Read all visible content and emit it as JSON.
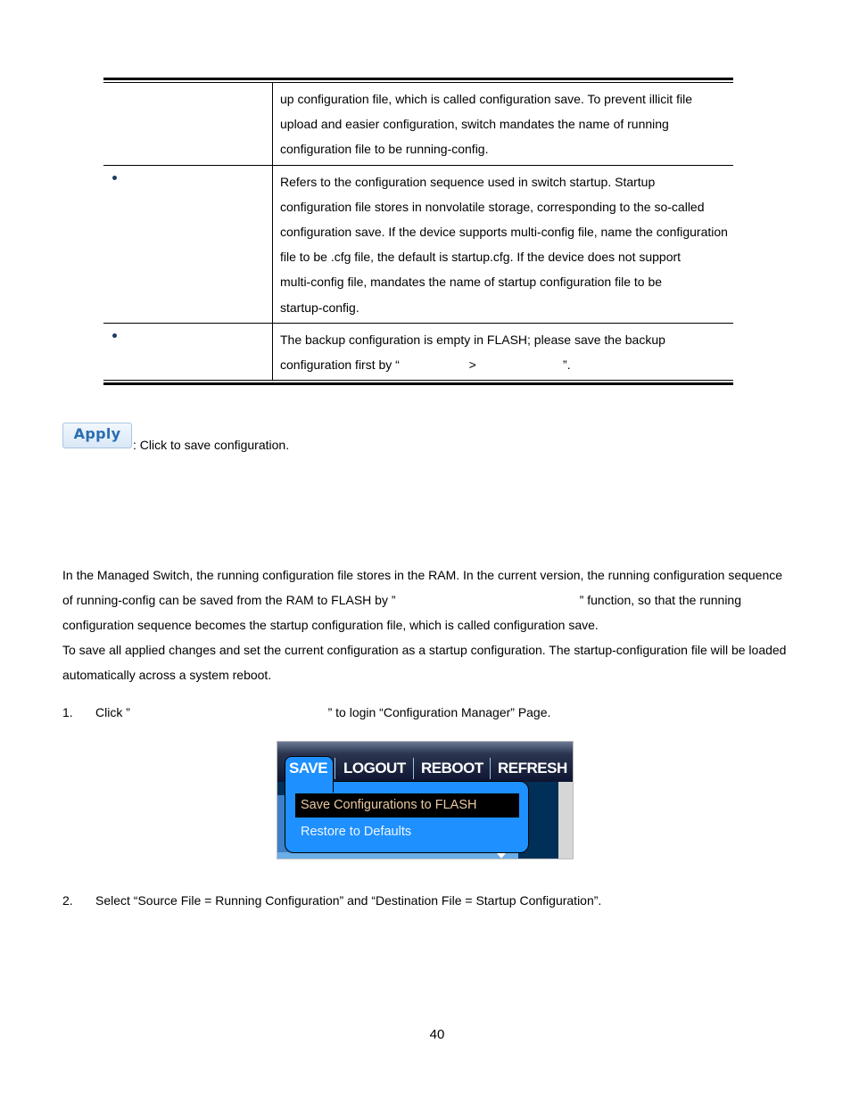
{
  "table": {
    "rows": [
      {
        "has_bullet": false,
        "label": "",
        "lines": [
          "up configuration file, which is called configuration save. To prevent illicit file",
          "upload and easier configuration, switch mandates the name of running",
          "configuration file to be running-config."
        ]
      },
      {
        "has_bullet": true,
        "label": "",
        "lines": [
          "Refers to the configuration sequence used in switch startup. Startup",
          "configuration file stores in nonvolatile storage, corresponding to the so-called",
          "configuration save. If the device supports multi-config file, name the configuration",
          "file to be .cfg file, the default is startup.cfg. If the device does not support",
          "multi-config file, mandates the name of startup configuration file to be",
          "startup-config."
        ]
      },
      {
        "has_bullet": true,
        "label": "",
        "lines": [
          "The backup configuration is empty in FLASH; please save the backup",
          "configuration first by “                    >                         ”."
        ]
      }
    ]
  },
  "apply": {
    "button_label": "Apply",
    "description": ": Click to save configuration."
  },
  "intro": {
    "lines": [
      "In the Managed Switch, the running configuration file stores in the RAM. In the current version, the running configuration sequence",
      "of running-config can be saved from the RAM to FLASH by ”                                                     ” function, so that the running",
      "configuration sequence becomes the startup configuration file, which is called configuration save.",
      "To save all applied changes and set the current configuration as a startup configuration. The startup-configuration file will be loaded",
      "automatically across a system reboot."
    ]
  },
  "steps": [
    {
      "number": "1.",
      "text": "Click ”                                                         ” to login “Configuration Manager” Page."
    },
    {
      "number": "2.",
      "text": "Select “Source File = Running Configuration” and “Destination File = Startup Configuration”."
    }
  ],
  "screenshot": {
    "nav": [
      "SAVE",
      "LOGOUT",
      "REBOOT",
      "REFRESH"
    ],
    "menu_items": [
      "Save Configurations to FLASH",
      "Restore to Defaults"
    ],
    "highlighted_item": "Save Configurations to FLASH",
    "colors": {
      "accent": "#1e90ff",
      "bar": "#0e1530",
      "panel": "#003057",
      "highlight_bg": "#000000",
      "highlight_text": "#e8c9a0"
    }
  },
  "page_number": "40"
}
